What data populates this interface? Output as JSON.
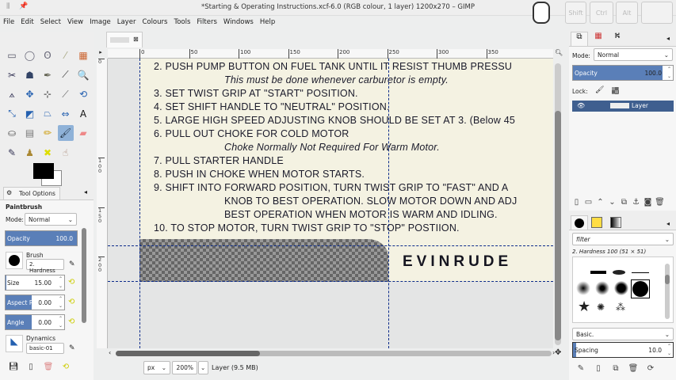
{
  "window": {
    "title": "*Starting & Operating Instructions.xcf-6.0 (RGB colour, 1 layer) 1200x270 – GIMP",
    "keys": [
      "Shift",
      "Ctrl",
      "Alt",
      ""
    ]
  },
  "menu": [
    "File",
    "Edit",
    "Select",
    "View",
    "Image",
    "Layer",
    "Colours",
    "Tools",
    "Filters",
    "Windows",
    "Help"
  ],
  "tools": [
    {
      "name": "rect-select-icon",
      "g": "▭",
      "c": "#556"
    },
    {
      "name": "ellipse-select-icon",
      "g": "◯",
      "c": "#667"
    },
    {
      "name": "free-select-icon",
      "g": "ʘ",
      "c": "#667"
    },
    {
      "name": "fuzzy-select-icon",
      "g": "⁄",
      "c": "#aa8"
    },
    {
      "name": "color-select-icon",
      "g": "▦",
      "c": "#c63"
    },
    {
      "name": "scissors-icon",
      "g": "✂",
      "c": "#335"
    },
    {
      "name": "foreground-select-icon",
      "g": "☗",
      "c": "#346"
    },
    {
      "name": "paths-icon",
      "g": "✒",
      "c": "#665"
    },
    {
      "name": "color-picker-icon",
      "g": "⟋",
      "c": "#333"
    },
    {
      "name": "zoom-icon",
      "g": "🔍",
      "c": "#558"
    },
    {
      "name": "measure-icon",
      "g": "⟑",
      "c": "#335"
    },
    {
      "name": "move-icon",
      "g": "✥",
      "c": "#2460b0"
    },
    {
      "name": "align-icon",
      "g": "⊹",
      "c": "#333"
    },
    {
      "name": "crop-icon",
      "g": "⟋",
      "c": "#666"
    },
    {
      "name": "rotate-icon",
      "g": "⟲",
      "c": "#2460b0"
    },
    {
      "name": "scale-icon",
      "g": "⤡",
      "c": "#2460b0"
    },
    {
      "name": "shear-icon",
      "g": "◩",
      "c": "#2460b0"
    },
    {
      "name": "perspective-icon",
      "g": "⏢",
      "c": "#2460b0"
    },
    {
      "name": "flip-icon",
      "g": "⇔",
      "c": "#2460b0"
    },
    {
      "name": "text-icon",
      "g": "A",
      "c": "#111"
    },
    {
      "name": "bucket-fill-icon",
      "g": "⛀",
      "c": "#555"
    },
    {
      "name": "gradient-icon",
      "g": "▤",
      "c": "#777"
    },
    {
      "name": "pencil-icon",
      "g": "✏",
      "c": "#c90"
    },
    {
      "name": "paintbrush-icon",
      "g": "🖌",
      "c": "#234"
    },
    {
      "name": "eraser-icon",
      "g": "▰",
      "c": "#e88"
    },
    {
      "name": "ink-icon",
      "g": "✎",
      "c": "#335"
    },
    {
      "name": "clone-icon",
      "g": "♟",
      "c": "#a83"
    },
    {
      "name": "heal-icon",
      "g": "✖",
      "c": "#dd0"
    },
    {
      "name": "smudge-icon",
      "g": "☝",
      "c": "#a87"
    }
  ],
  "tool_options": {
    "tab": "Tool Options",
    "tool": "Paintbrush",
    "mode_label": "Mode:",
    "mode": "Normal",
    "opacity_label": "Opacity",
    "opacity": "100.0",
    "opacity_pct": 100,
    "brush_label": "Brush",
    "brush": "2. Hardness",
    "size_label": "Size",
    "size": "15.00",
    "aspect_label": "Aspect R...",
    "aspect": "0.00",
    "angle_label": "Angle",
    "angle": "0.00",
    "dynamics_label": "Dynamics",
    "dynamics": "basic-01"
  },
  "ruler": {
    "top": [
      "0",
      "50",
      "100",
      "150",
      "200",
      "250",
      "300",
      "350"
    ],
    "left": [
      "0",
      "100",
      "150",
      "200"
    ]
  },
  "image": {
    "lines": [
      {
        "t": "2. PUSH PUMP BUTTON ON FUEL TANK UNTIL IT RESIST THUMB PRESSU",
        "i": false
      },
      {
        "t": "This must be done whenever carburetor is empty.",
        "i": true
      },
      {
        "t": "3. SET TWIST GRIP AT \"START\" POSITION.",
        "i": false
      },
      {
        "t": "4. SET SHIFT HANDLE TO \"NEUTRAL\" POSITION.",
        "i": false
      },
      {
        "t": "5. LARGE HIGH SPEED ADJUSTING KNOB SHOULD BE SET AT 3. (Below 45",
        "i": false
      },
      {
        "t": "6. PULL OUT CHOKE FOR COLD MOTOR",
        "i": false
      },
      {
        "t": "Choke Normally Not Required For Warm Motor.",
        "i": true
      },
      {
        "t": "7. PULL STARTER HANDLE",
        "i": false
      },
      {
        "t": "8. PUSH IN CHOKE WHEN MOTOR STARTS.",
        "i": false
      },
      {
        "t": "9. SHIFT INTO FORWARD POSITION, TURN TWIST GRIP TO \"FAST\" AND A",
        "i": false
      },
      {
        "t": "KNOB TO BEST OPERATION. SLOW MOTOR DOWN AND ADJ",
        "i": false
      },
      {
        "t": "BEST OPERATION WHEN MOTOR IS WARM AND IDLING.",
        "i": false
      },
      {
        "t": "10. TO STOP MOTOR, TURN TWIST GRIP TO \"STOP\" POSTIION.",
        "i": false
      }
    ],
    "brand": "EVINRUDE"
  },
  "status": {
    "unit": "px",
    "zoom": "200%",
    "info": "Layer (9.5 MB)",
    "scroll_fraction": 0.33
  },
  "layers": {
    "mode_label": "Mode:",
    "mode": "Normal",
    "opacity_label": "Opacity",
    "opacity": "100.0",
    "lock_label": "Lock:",
    "layer_name": "Layer"
  },
  "brushes": {
    "filter_placeholder": "filter",
    "selected": "2. Hardness 100 (51 × 51)",
    "set": "Basic.",
    "spacing_label": "Spacing",
    "spacing": "10.0"
  }
}
